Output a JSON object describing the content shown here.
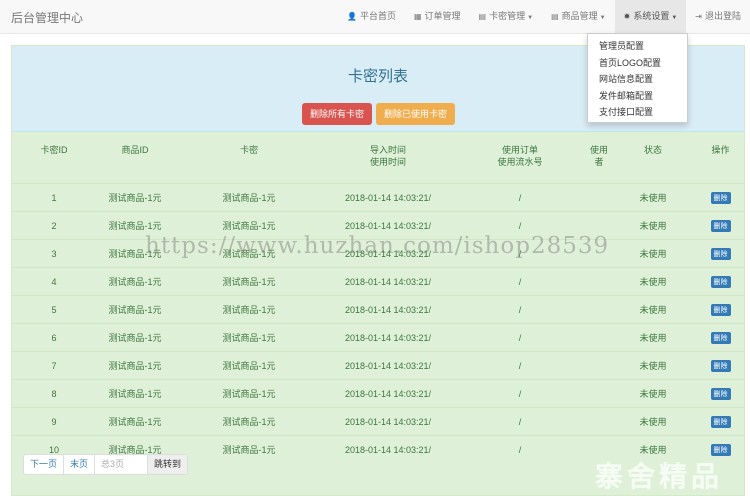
{
  "brand": "后台管理中心",
  "nav": [
    {
      "label": "平台首页",
      "icon": "user-icon",
      "glyph": "👤"
    },
    {
      "label": "订单管理",
      "icon": "calendar-icon",
      "glyph": "▦"
    },
    {
      "label": "卡密管理",
      "icon": "list-icon",
      "glyph": "▤",
      "caret": "▼"
    },
    {
      "label": "商品管理",
      "icon": "list-icon",
      "glyph": "▤",
      "caret": "▼"
    },
    {
      "label": "系统设置",
      "icon": "gear-icon",
      "glyph": "✹",
      "caret": "▼"
    },
    {
      "label": "退出登陆",
      "icon": "logout-icon",
      "glyph": "⇥"
    }
  ],
  "dropdown": [
    "管理员配置",
    "首页LOGO配置",
    "网站信息配置",
    "发件邮箱配置",
    "支付接口配置"
  ],
  "panel": {
    "title": "卡密列表",
    "delete_all": "删除所有卡密",
    "delete_used": "删除已使用卡密"
  },
  "table": {
    "headers": [
      "卡密ID",
      "商品ID",
      "卡密",
      "导入时间",
      "使用时间",
      "使用订单",
      "使用流水号",
      "使用者",
      "状态",
      "操作"
    ],
    "rows": [
      {
        "id": "1",
        "product": "测试商品-1元",
        "card": "测试商品-1元",
        "time": "2018-01-14 14:03:21/",
        "order": "/",
        "user": "",
        "status": "未使用",
        "action": "删除"
      },
      {
        "id": "2",
        "product": "测试商品-1元",
        "card": "测试商品-1元",
        "time": "2018-01-14 14:03:21/",
        "order": "/",
        "user": "",
        "status": "未使用",
        "action": "删除"
      },
      {
        "id": "3",
        "product": "测试商品-1元",
        "card": "测试商品-1元",
        "time": "2018-01-14 14:03:21/",
        "order": "/",
        "user": "",
        "status": "未使用",
        "action": "删除"
      },
      {
        "id": "4",
        "product": "测试商品-1元",
        "card": "测试商品-1元",
        "time": "2018-01-14 14:03:21/",
        "order": "/",
        "user": "",
        "status": "未使用",
        "action": "删除"
      },
      {
        "id": "5",
        "product": "测试商品-1元",
        "card": "测试商品-1元",
        "time": "2018-01-14 14:03:21/",
        "order": "/",
        "user": "",
        "status": "未使用",
        "action": "删除"
      },
      {
        "id": "6",
        "product": "测试商品-1元",
        "card": "测试商品-1元",
        "time": "2018-01-14 14:03:21/",
        "order": "/",
        "user": "",
        "status": "未使用",
        "action": "删除"
      },
      {
        "id": "7",
        "product": "测试商品-1元",
        "card": "测试商品-1元",
        "time": "2018-01-14 14:03:21/",
        "order": "/",
        "user": "",
        "status": "未使用",
        "action": "删除"
      },
      {
        "id": "8",
        "product": "测试商品-1元",
        "card": "测试商品-1元",
        "time": "2018-01-14 14:03:21/",
        "order": "/",
        "user": "",
        "status": "未使用",
        "action": "删除"
      },
      {
        "id": "9",
        "product": "测试商品-1元",
        "card": "测试商品-1元",
        "time": "2018-01-14 14:03:21/",
        "order": "/",
        "user": "",
        "status": "未使用",
        "action": "删除"
      },
      {
        "id": "10",
        "product": "测试商品-1元",
        "card": "测试商品-1元",
        "time": "2018-01-14 14:03:21/",
        "order": "/",
        "user": "",
        "status": "未使用",
        "action": "删除"
      }
    ]
  },
  "pager": {
    "next": "下一页",
    "last": "末页",
    "placeholder": "总3页",
    "go": "跳转到"
  },
  "watermark": {
    "url": "https://www.huzhan.com/ishop28539",
    "text": "寨舍精品"
  }
}
